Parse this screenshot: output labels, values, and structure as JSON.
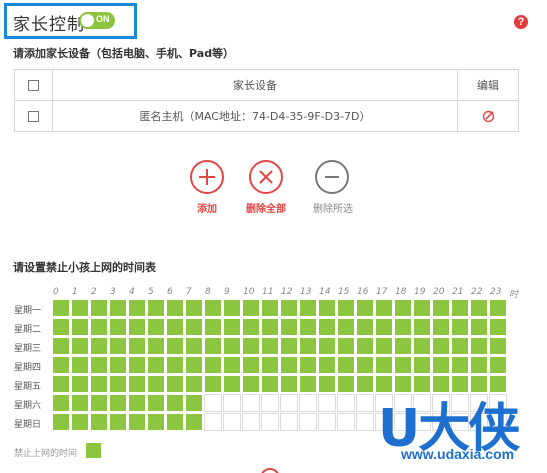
{
  "header": {
    "title": "家长控制",
    "toggle_label": "ON"
  },
  "help_icon": "?",
  "devices": {
    "section_title": "请添加家长设备（包括电脑、手机、Pad等）",
    "columns": {
      "device": "家长设备",
      "edit": "编辑"
    },
    "rows": [
      {
        "name": "匿名主机（MAC地址：74-D4-35-9F-D3-7D）"
      }
    ]
  },
  "actions": {
    "add": "添加",
    "delete_all": "删除全部",
    "delete_selected": "删除所选"
  },
  "schedule": {
    "section_title": "请设置禁止小孩上网的时间表",
    "hours": [
      "0",
      "1",
      "2",
      "3",
      "4",
      "5",
      "6",
      "7",
      "8",
      "9",
      "10",
      "11",
      "12",
      "13",
      "14",
      "15",
      "16",
      "17",
      "18",
      "19",
      "20",
      "21",
      "22",
      "23",
      "时"
    ],
    "days": [
      {
        "label": "星期一",
        "blocked_until_hour": 24
      },
      {
        "label": "星期二",
        "blocked_until_hour": 24
      },
      {
        "label": "星期三",
        "blocked_until_hour": 24
      },
      {
        "label": "星期四",
        "blocked_until_hour": 24
      },
      {
        "label": "星期五",
        "blocked_until_hour": 24
      },
      {
        "label": "星期六",
        "blocked_until_hour": 8
      },
      {
        "label": "星期日",
        "blocked_until_hour": 8
      }
    ],
    "legend": "禁止上网的时间"
  },
  "colors": {
    "accent_green": "#8cc53f",
    "accent_red": "#e04848",
    "highlight_blue": "#1a8ad8"
  },
  "watermark": {
    "text": "U大侠",
    "url": "www.udaxia.com"
  }
}
